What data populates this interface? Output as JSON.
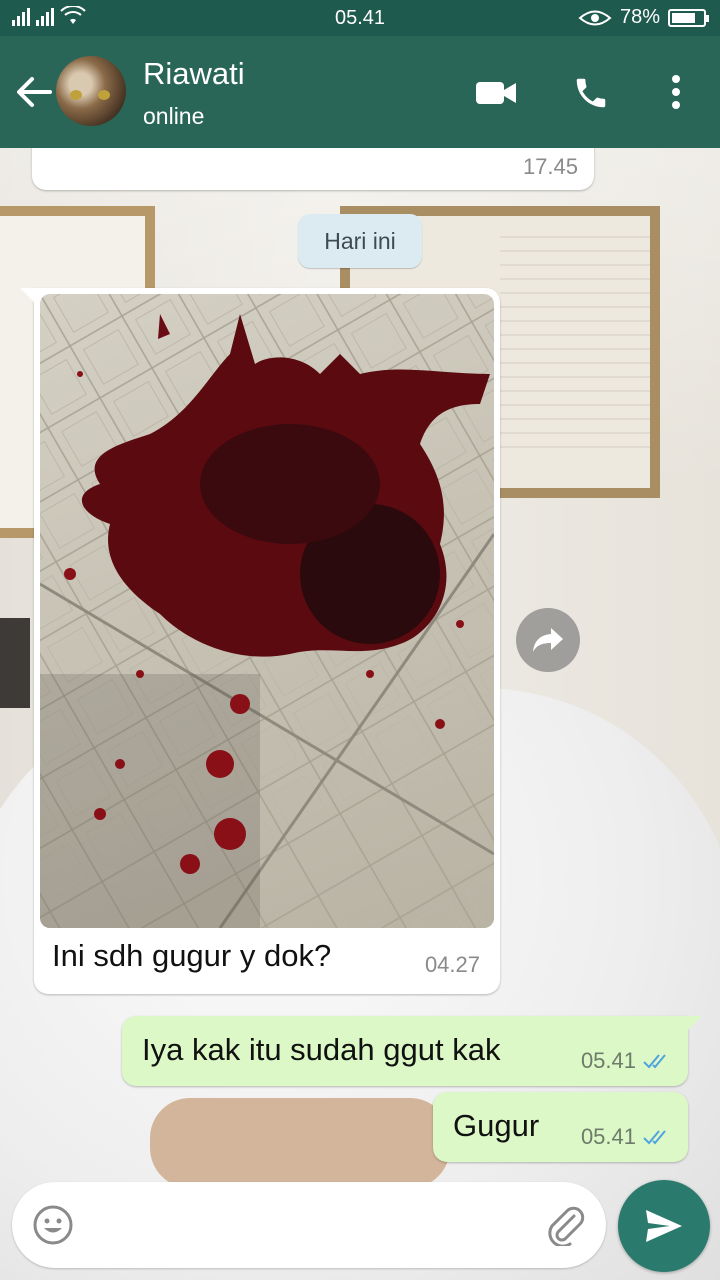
{
  "status_bar": {
    "time": "05.41",
    "battery": "78%",
    "battery_level": 0.78
  },
  "header": {
    "contact_name": "Riawati",
    "contact_status": "online",
    "icons": [
      "back-arrow-icon",
      "video-call-icon",
      "phone-call-icon",
      "more-options-icon"
    ]
  },
  "messages": {
    "prev_time": "17.45",
    "date_separator": "Hari ini",
    "incoming": {
      "caption": "Ini sdh gugur y dok?",
      "time": "04.27"
    },
    "outgoing": [
      {
        "text": "Iya kak itu sudah ggut kak",
        "time": "05.41",
        "status": "read"
      },
      {
        "text": "Gugur",
        "time": "05.41",
        "status": "read"
      }
    ]
  },
  "composer": {
    "placeholder": "",
    "value": ""
  },
  "colors": {
    "header": "#2a6657",
    "status_bar": "#1f5a4e",
    "outgoing_bubble": "#dcf8c6",
    "incoming_bubble": "#ffffff",
    "read_ticks": "#4fc3f7",
    "send_button": "#2a7b6d"
  }
}
